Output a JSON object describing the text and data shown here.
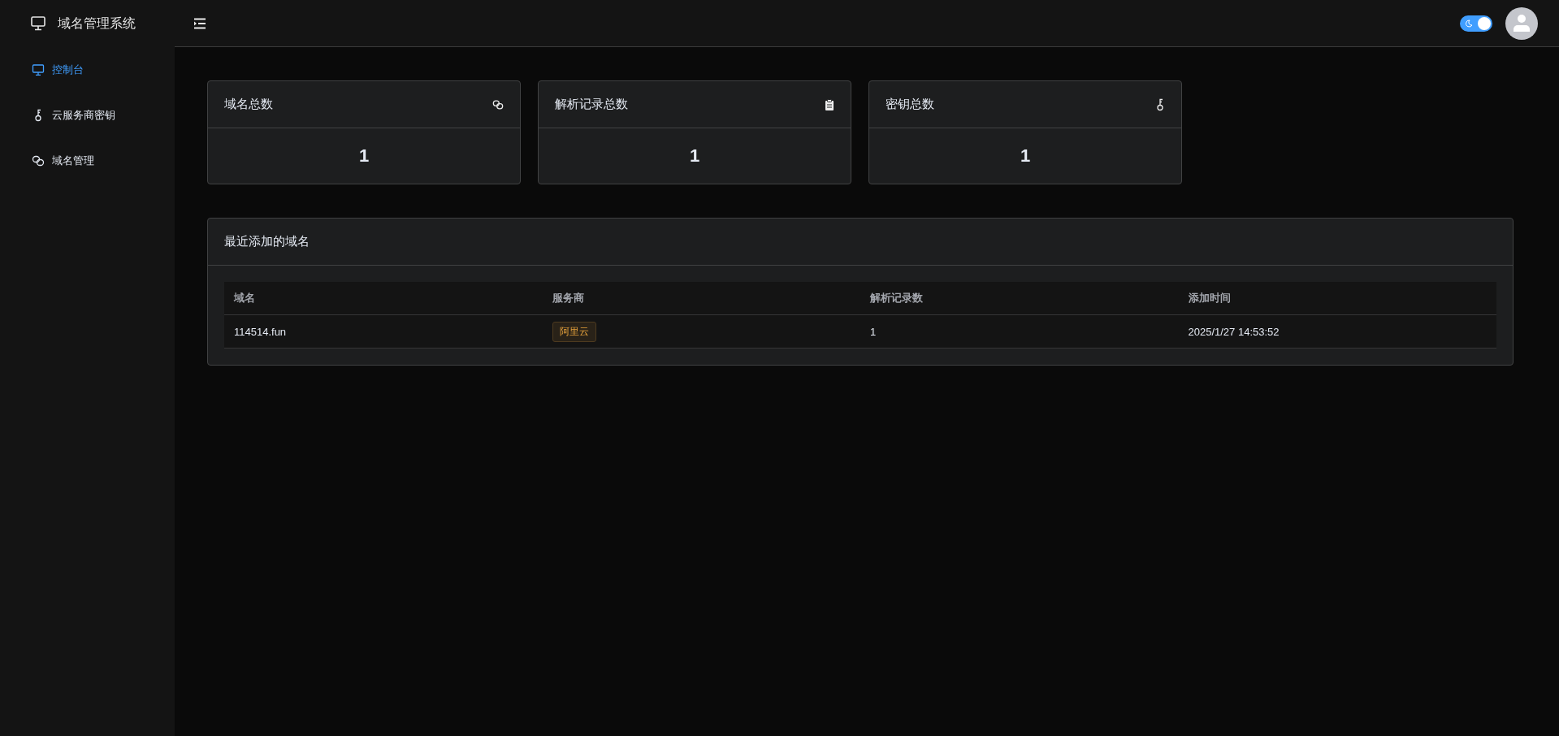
{
  "sidebar": {
    "title": "域名管理系统",
    "items": [
      {
        "label": "控制台",
        "kind": "dashboard",
        "selected": true
      },
      {
        "label": "云服务商密钥",
        "kind": "keys",
        "selected": false
      },
      {
        "label": "域名管理",
        "kind": "domains",
        "selected": false
      }
    ]
  },
  "header": {
    "theme_toggle": {
      "on": true
    }
  },
  "stats": [
    {
      "label": "域名总数",
      "kind": "domains",
      "value": "1"
    },
    {
      "label": "解析记录总数",
      "kind": "records",
      "value": "1"
    },
    {
      "label": "密钥总数",
      "kind": "keys",
      "value": "1"
    }
  ],
  "recent": {
    "title": "最近添加的域名",
    "columns": [
      "域名",
      "服务商",
      "解析记录数",
      "添加时间"
    ],
    "rows": [
      {
        "domain": "114514.fun",
        "provider": "阿里云",
        "records": "1",
        "added": "2025/1/27 14:53:52"
      }
    ]
  }
}
